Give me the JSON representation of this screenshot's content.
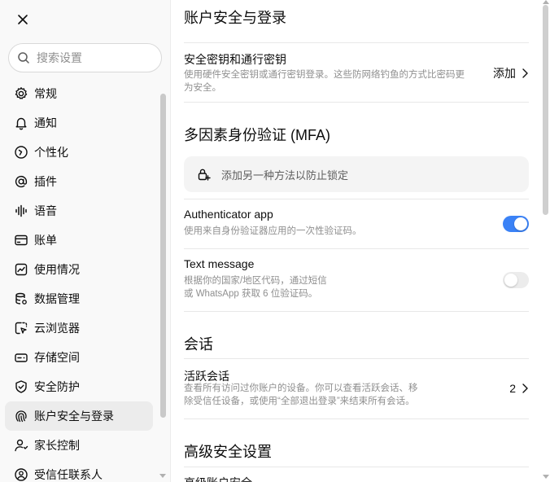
{
  "sidebar": {
    "close_label": "",
    "search_placeholder": "搜索设置",
    "items": [
      {
        "label": "常规",
        "icon": "gear-icon",
        "active": false
      },
      {
        "label": "通知",
        "icon": "bell-icon",
        "active": false
      },
      {
        "label": "个性化",
        "icon": "personalize-icon",
        "active": false
      },
      {
        "label": "插件",
        "icon": "at-icon",
        "active": false
      },
      {
        "label": "语音",
        "icon": "voice-wave-icon",
        "active": false
      },
      {
        "label": "账单",
        "icon": "card-icon",
        "active": false
      },
      {
        "label": "使用情况",
        "icon": "chart-icon",
        "active": false
      },
      {
        "label": "数据管理",
        "icon": "database-icon",
        "active": false
      },
      {
        "label": "云浏览器",
        "icon": "cloud-browser-icon",
        "active": false
      },
      {
        "label": "存储空间",
        "icon": "storage-icon",
        "active": false
      },
      {
        "label": "安全防护",
        "icon": "shield-icon",
        "active": false
      },
      {
        "label": "账户安全与登录",
        "icon": "fingerprint-icon",
        "active": true
      },
      {
        "label": "家长控制",
        "icon": "parent-icon",
        "active": false
      },
      {
        "label": "受信任联系人",
        "icon": "contact-icon",
        "active": false
      }
    ]
  },
  "main": {
    "section1_title": "账户安全与登录",
    "passkey": {
      "title": "安全密钥和通行密钥",
      "desc_line1": "使用硬件安全密钥或通行密钥登录。这些防网络钓鱼的方式比密码更",
      "desc_line2": "为安全。",
      "action": "添加"
    },
    "mfa_title": "多因素身份验证 (MFA)",
    "mfa_add": "添加另一种方法以防止锁定",
    "auth_app": {
      "title": "Authenticator app",
      "desc": "使用来自身份验证器应用的一次性验证码。",
      "enabled": true
    },
    "text_message": {
      "title": "Text message",
      "desc_line1": "根据你的国家/地区代码，通过短信",
      "desc_line2": "或 WhatsApp 获取 6 位验证码。",
      "enabled": false
    },
    "sessions_title": "会话",
    "active_sessions": {
      "title": "活跃会话",
      "desc_line1": "查看所有访问过你账户的设备。你可以查看活跃会话、移",
      "desc_line2": "除受信任设备，或使用“全部退出登录”来结束所有会话。",
      "count": "2"
    },
    "advanced_title": "高级安全设置",
    "advanced_row": "高级账户安全"
  },
  "colors": {
    "accent": "#3b82f6",
    "sidebar_bg": "#f9f9f9",
    "active_item_bg": "#ececec",
    "muted_text": "#8f8f8f"
  }
}
